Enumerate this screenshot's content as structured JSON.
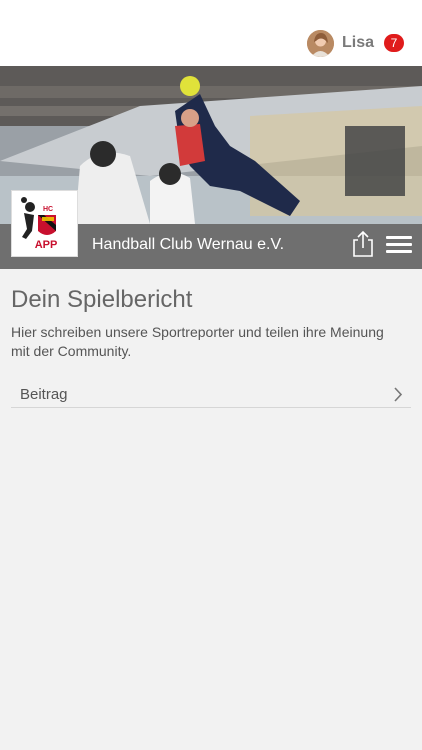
{
  "header": {
    "user_name": "Lisa",
    "notification_count": "7",
    "icons": [
      "avatar",
      "notification-badge"
    ]
  },
  "club": {
    "name": "Handball Club Wernau e.V.",
    "logo_text": "APP",
    "logo_initials": "HC"
  },
  "toolbar": {
    "icons": [
      "share-icon",
      "hamburger-menu-icon"
    ]
  },
  "main": {
    "title": "Dein Spielbericht",
    "description": "Hier schreiben unsere Sportreporter und teilen ihre Meinung mit der Community.",
    "items": [
      {
        "label": "Beitrag"
      }
    ]
  },
  "colors": {
    "club_bar": "#6f6f6f",
    "badge": "#e01b1b",
    "page_bg": "#f2f2f2"
  }
}
